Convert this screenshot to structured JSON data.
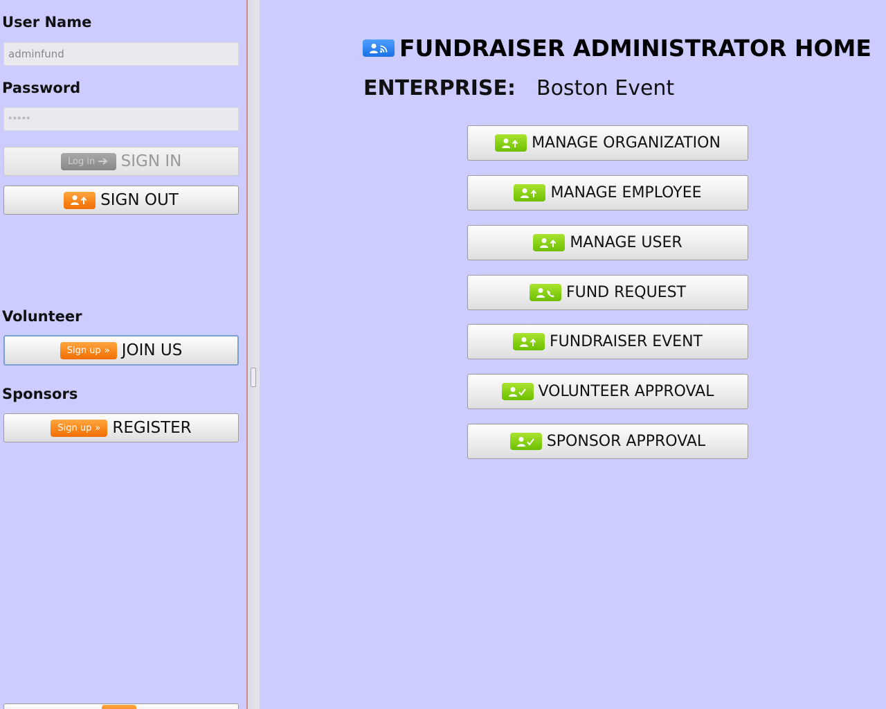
{
  "login": {
    "username_label": "User Name",
    "username_value": "adminfund",
    "password_label": "Password",
    "password_value": "*****",
    "signin_badge": "Log in",
    "signin_label": "SIGN IN",
    "signout_label": "SIGN OUT"
  },
  "volunteer": {
    "heading": "Volunteer",
    "badge": "Sign up",
    "button_label": "JOIN US"
  },
  "sponsors": {
    "heading": "Sponsors",
    "badge": "Sign up",
    "button_label": "REGISTER"
  },
  "main": {
    "title": "FUNDRAISER ADMINISTRATOR HOME",
    "enterprise_label": "ENTERPRISE:",
    "enterprise_value": "Boston Event",
    "buttons": [
      {
        "label": "MANAGE ORGANIZATION",
        "icon": "user-up-icon"
      },
      {
        "label": "MANAGE EMPLOYEE",
        "icon": "user-up-icon"
      },
      {
        "label": "MANAGE USER",
        "icon": "user-up-icon"
      },
      {
        "label": "FUND REQUEST",
        "icon": "user-phone-icon"
      },
      {
        "label": "FUNDRAISER EVENT",
        "icon": "user-up-icon"
      },
      {
        "label": "VOLUNTEER APPROVAL",
        "icon": "user-check-icon"
      },
      {
        "label": "SPONSOR APPROVAL",
        "icon": "user-check-icon"
      }
    ]
  },
  "colors": {
    "background": "#ccccff",
    "orange_badge": "#f58a1f",
    "green_badge": "#8cd11a",
    "blue_badge": "#2f86f5"
  }
}
